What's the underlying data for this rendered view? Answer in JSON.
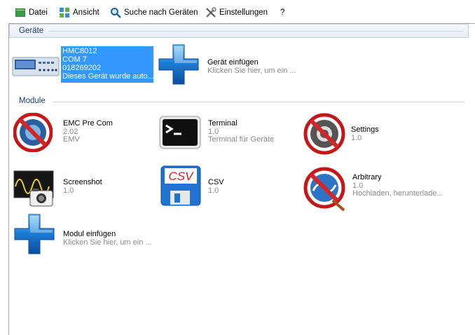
{
  "menu": {
    "datei": "Datei",
    "ansicht": "Ansicht",
    "suche": "Suche nach Geräten",
    "einstellungen": "Einstellungen",
    "help": "?"
  },
  "geraete_group": {
    "title": "Geräte",
    "device": {
      "name": "HMC8012",
      "port": "COM 7",
      "serial": "018269202",
      "status": "Dieses Gerät wurde auto..."
    },
    "add_device": {
      "title": "Gerät einfügen",
      "subtitle": "Klicken Sie hier, um ein ..."
    }
  },
  "module_group": {
    "title": "Module",
    "modules": [
      {
        "name": "EMC Pre Com",
        "version": "2.02",
        "description": "EMV",
        "icon": "forbidden-icon"
      },
      {
        "name": "Terminal",
        "version": "1.0",
        "description": "Terminal für Geräte",
        "icon": "terminal-icon"
      },
      {
        "name": "Settings",
        "version": "1.0",
        "description": "",
        "icon": "settings-forbidden-icon"
      },
      {
        "name": "Screenshot",
        "version": "1.0",
        "description": "",
        "icon": "screenshot-icon"
      },
      {
        "name": "CSV",
        "version": "1.0",
        "description": "",
        "icon": "csv-icon"
      },
      {
        "name": "Arbitrary",
        "version": "1.0",
        "description": "Hochladen, herunterlade...",
        "icon": "arbitrary-forbidden-icon"
      }
    ],
    "add_module": {
      "title": "Modul einfügen",
      "subtitle": "Klicken Sie hier, um ein ..."
    }
  },
  "colors": {
    "selection": "#3399ff",
    "group_title": "#1e3a78",
    "secondary_text": "#8a8a8a",
    "plus_blue": "#1e7fd6"
  }
}
